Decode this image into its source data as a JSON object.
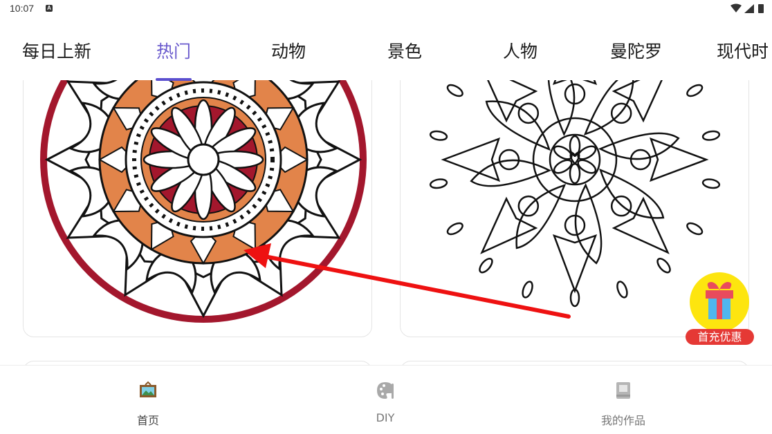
{
  "status": {
    "time": "10:07",
    "notification_badge": "A"
  },
  "tabs": [
    {
      "label": "每日上新",
      "active": false
    },
    {
      "label": "热门",
      "active": true
    },
    {
      "label": "动物",
      "active": false
    },
    {
      "label": "景色",
      "active": false
    },
    {
      "label": "人物",
      "active": false
    },
    {
      "label": "曼陀罗",
      "active": false
    },
    {
      "label": "现代时",
      "active": false
    }
  ],
  "cards": [
    {
      "kind": "colored-mandala",
      "colors": [
        "#e2844a",
        "#a3172d"
      ]
    },
    {
      "kind": "outline-mandala"
    }
  ],
  "promo": {
    "label": "首充优惠",
    "icon": "gift-icon"
  },
  "nav": [
    {
      "label": "首页",
      "icon": "picture-frame-icon",
      "active": true
    },
    {
      "label": "DIY",
      "icon": "palette-icon",
      "active": false
    },
    {
      "label": "我的作品",
      "icon": "book-icon",
      "active": false
    }
  ],
  "colors": {
    "accent": "#5b4fcf",
    "promo_yellow": "#fde50f",
    "promo_red": "#e53935",
    "arrow": "#ee1111"
  }
}
